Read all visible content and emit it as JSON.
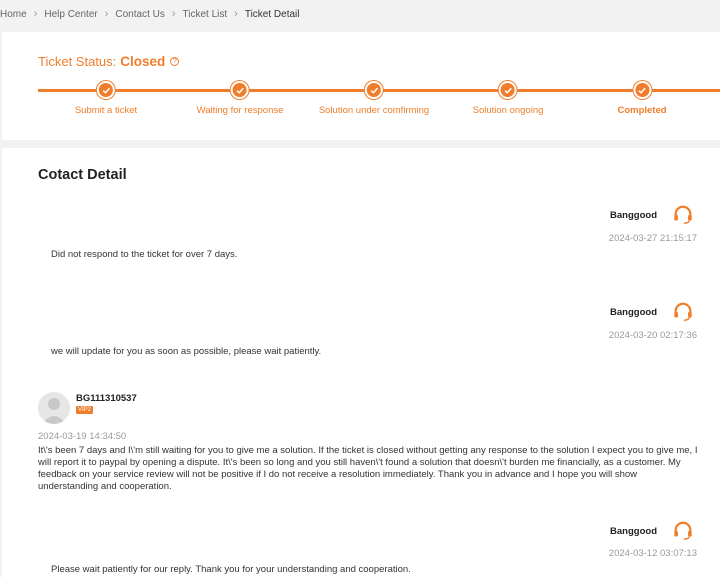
{
  "breadcrumb": [
    "Home",
    "Help Center",
    "Contact Us",
    "Ticket List",
    "Ticket Detail"
  ],
  "status": {
    "label": "Ticket Status:",
    "value": "Closed",
    "steps": [
      "Submit a ticket",
      "Waiting for response",
      "Solution under comfirming",
      "Solution ongoing",
      "Completed"
    ]
  },
  "detail": {
    "title": "Cotact Detail",
    "messages": [
      {
        "sender": "Banggood",
        "time": "2024-03-27 21:15:17",
        "text": "Did not respond to the ticket for over 7 days."
      },
      {
        "sender": "Banggood",
        "time": "2024-03-20 02:17:36",
        "text": "we will update for you as soon as possible, please wait patiently."
      },
      {
        "sender": "BG111310537",
        "badge": "VIP2",
        "time": "2024-03-19 14:34:50",
        "text": "It\\'s been 7 days and I\\'m still waiting for you to give me a solution. If the ticket is closed without getting any response to the solution I expect you to give me, I will report it to paypal by opening a dispute. It\\'s been so long and you still haven\\'t found a solution that doesn\\'t burden me financially, as a customer. My feedback on your service review will not be positive if I do not receive a resolution immediately. Thank you in advance and I hope you will show understanding and cooperation."
      },
      {
        "sender": "Banggood",
        "time": "2024-03-12 03:07:13",
        "text": "Please wait patiently for our reply. Thank you for your understanding and cooperation."
      }
    ]
  },
  "colors": {
    "accent": "#f07d2b"
  }
}
